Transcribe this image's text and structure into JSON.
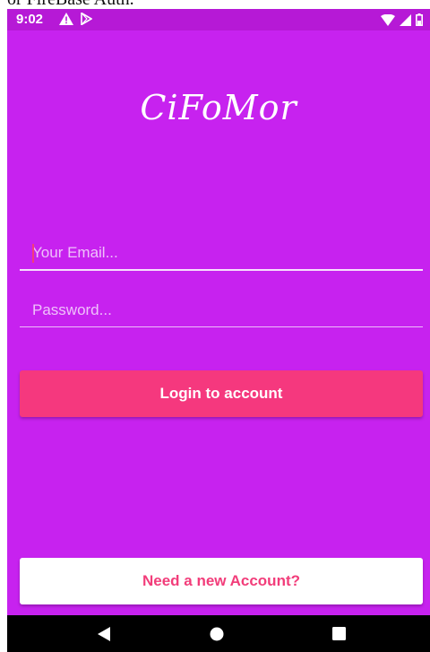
{
  "caption": {
    "text": "or FireBase Auth."
  },
  "status_bar": {
    "time": "9:02",
    "left_icons": [
      "warning-icon",
      "play-store-icon"
    ],
    "right_icons": [
      "wifi-icon",
      "signal-icon",
      "battery-icon"
    ]
  },
  "app": {
    "logo_text": "CiFoMor"
  },
  "login_form": {
    "email_placeholder": "Your Email...",
    "email_value": "",
    "password_placeholder": "Password...",
    "password_value": "",
    "login_button_label": "Login to account"
  },
  "footer": {
    "new_account_label": "Need a new Account?"
  },
  "nav_bar": {
    "buttons": [
      "back-icon",
      "home-icon",
      "recents-icon"
    ]
  },
  "colors": {
    "background": "#c722ef",
    "status_bar": "#b619d6",
    "accent": "#f5387e",
    "accent_text": "#f23d7a"
  }
}
